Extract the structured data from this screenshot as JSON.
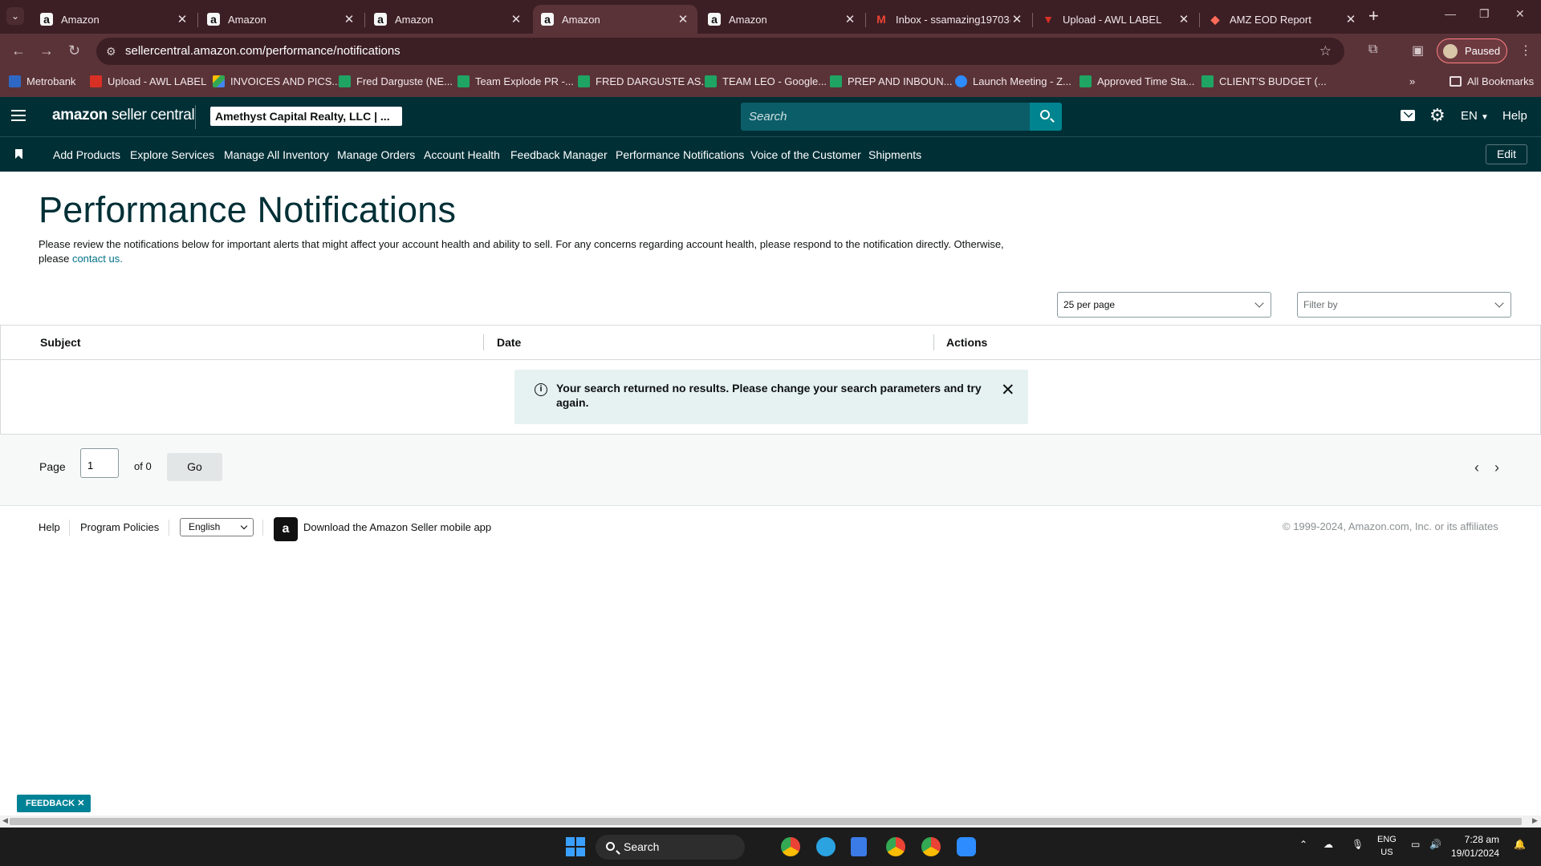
{
  "browser": {
    "tabs": [
      {
        "label": "Amazon",
        "favicon": "amazon-icon",
        "active": false
      },
      {
        "label": "Amazon",
        "favicon": "amazon-icon",
        "active": false
      },
      {
        "label": "Amazon",
        "favicon": "amazon-icon",
        "active": false
      },
      {
        "label": "Amazon",
        "favicon": "amazon-icon",
        "active": true
      },
      {
        "label": "Amazon",
        "favicon": "amazon-icon",
        "active": false
      },
      {
        "label": "Inbox - ssamazing19703@",
        "favicon": "gmail-icon",
        "active": false
      },
      {
        "label": "Upload - AWL LABEL",
        "favicon": "upload-icon",
        "active": false
      },
      {
        "label": "AMZ EOD Report",
        "favicon": "report-icon",
        "active": false
      }
    ],
    "url": "sellercentral.amazon.com/performance/notifications",
    "profile_label": "Paused",
    "bookmarks": [
      {
        "label": "Metrobank",
        "icon": "mb"
      },
      {
        "label": "Upload - AWL LABEL",
        "icon": "red"
      },
      {
        "label": "INVOICES AND PICS...",
        "icon": "drive"
      },
      {
        "label": "Fred Darguste (NE...",
        "icon": "green"
      },
      {
        "label": "Team Explode PR -...",
        "icon": "green"
      },
      {
        "label": "FRED DARGUSTE AS...",
        "icon": "green"
      },
      {
        "label": "TEAM LEO - Google...",
        "icon": "green"
      },
      {
        "label": "PREP AND INBOUN...",
        "icon": "green"
      },
      {
        "label": "Launch Meeting - Z...",
        "icon": "blue"
      },
      {
        "label": "Approved Time Sta...",
        "icon": "green"
      },
      {
        "label": "CLIENT'S BUDGET (...",
        "icon": "green"
      }
    ],
    "all_bookmarks_label": "All Bookmarks"
  },
  "header": {
    "logo_text": "amazon",
    "logo_suffix": "seller central",
    "account": "Amethyst Capital Realty, LLC | ...",
    "search_placeholder": "Search",
    "lang": "EN",
    "help": "Help"
  },
  "nav": {
    "items": [
      "Add Products",
      "Explore Services",
      "Manage All Inventory",
      "Manage Orders",
      "Account Health",
      "Feedback Manager",
      "Performance Notifications",
      "Voice of the Customer",
      "Shipments"
    ],
    "edit": "Edit"
  },
  "page": {
    "title": "Performance Notifications",
    "description": "Please review the notifications below for important alerts that might affect your account health and ability to sell. For any concerns regarding account health, please respond to the notification directly. Otherwise, please",
    "contact_link": "contact us.",
    "per_page": "25 per page",
    "filter_placeholder": "Filter by"
  },
  "table": {
    "columns": [
      "Subject",
      "Date",
      "Actions"
    ],
    "alert": "Your search returned no results. Please change your search parameters and try again."
  },
  "pagination": {
    "page_label": "Page",
    "page_value": "1",
    "of_label": "of 0",
    "go": "Go"
  },
  "footer": {
    "help": "Help",
    "program_policies": "Program Policies",
    "language": "English",
    "app_text": "Download the Amazon Seller mobile app",
    "copyright": "© 1999-2024, Amazon.com, Inc. or its affiliates"
  },
  "feedback": "FEEDBACK",
  "taskbar": {
    "search": "Search",
    "lang_top": "ENG",
    "lang_bottom": "US",
    "time": "7:28 am",
    "date": "19/01/2024"
  }
}
